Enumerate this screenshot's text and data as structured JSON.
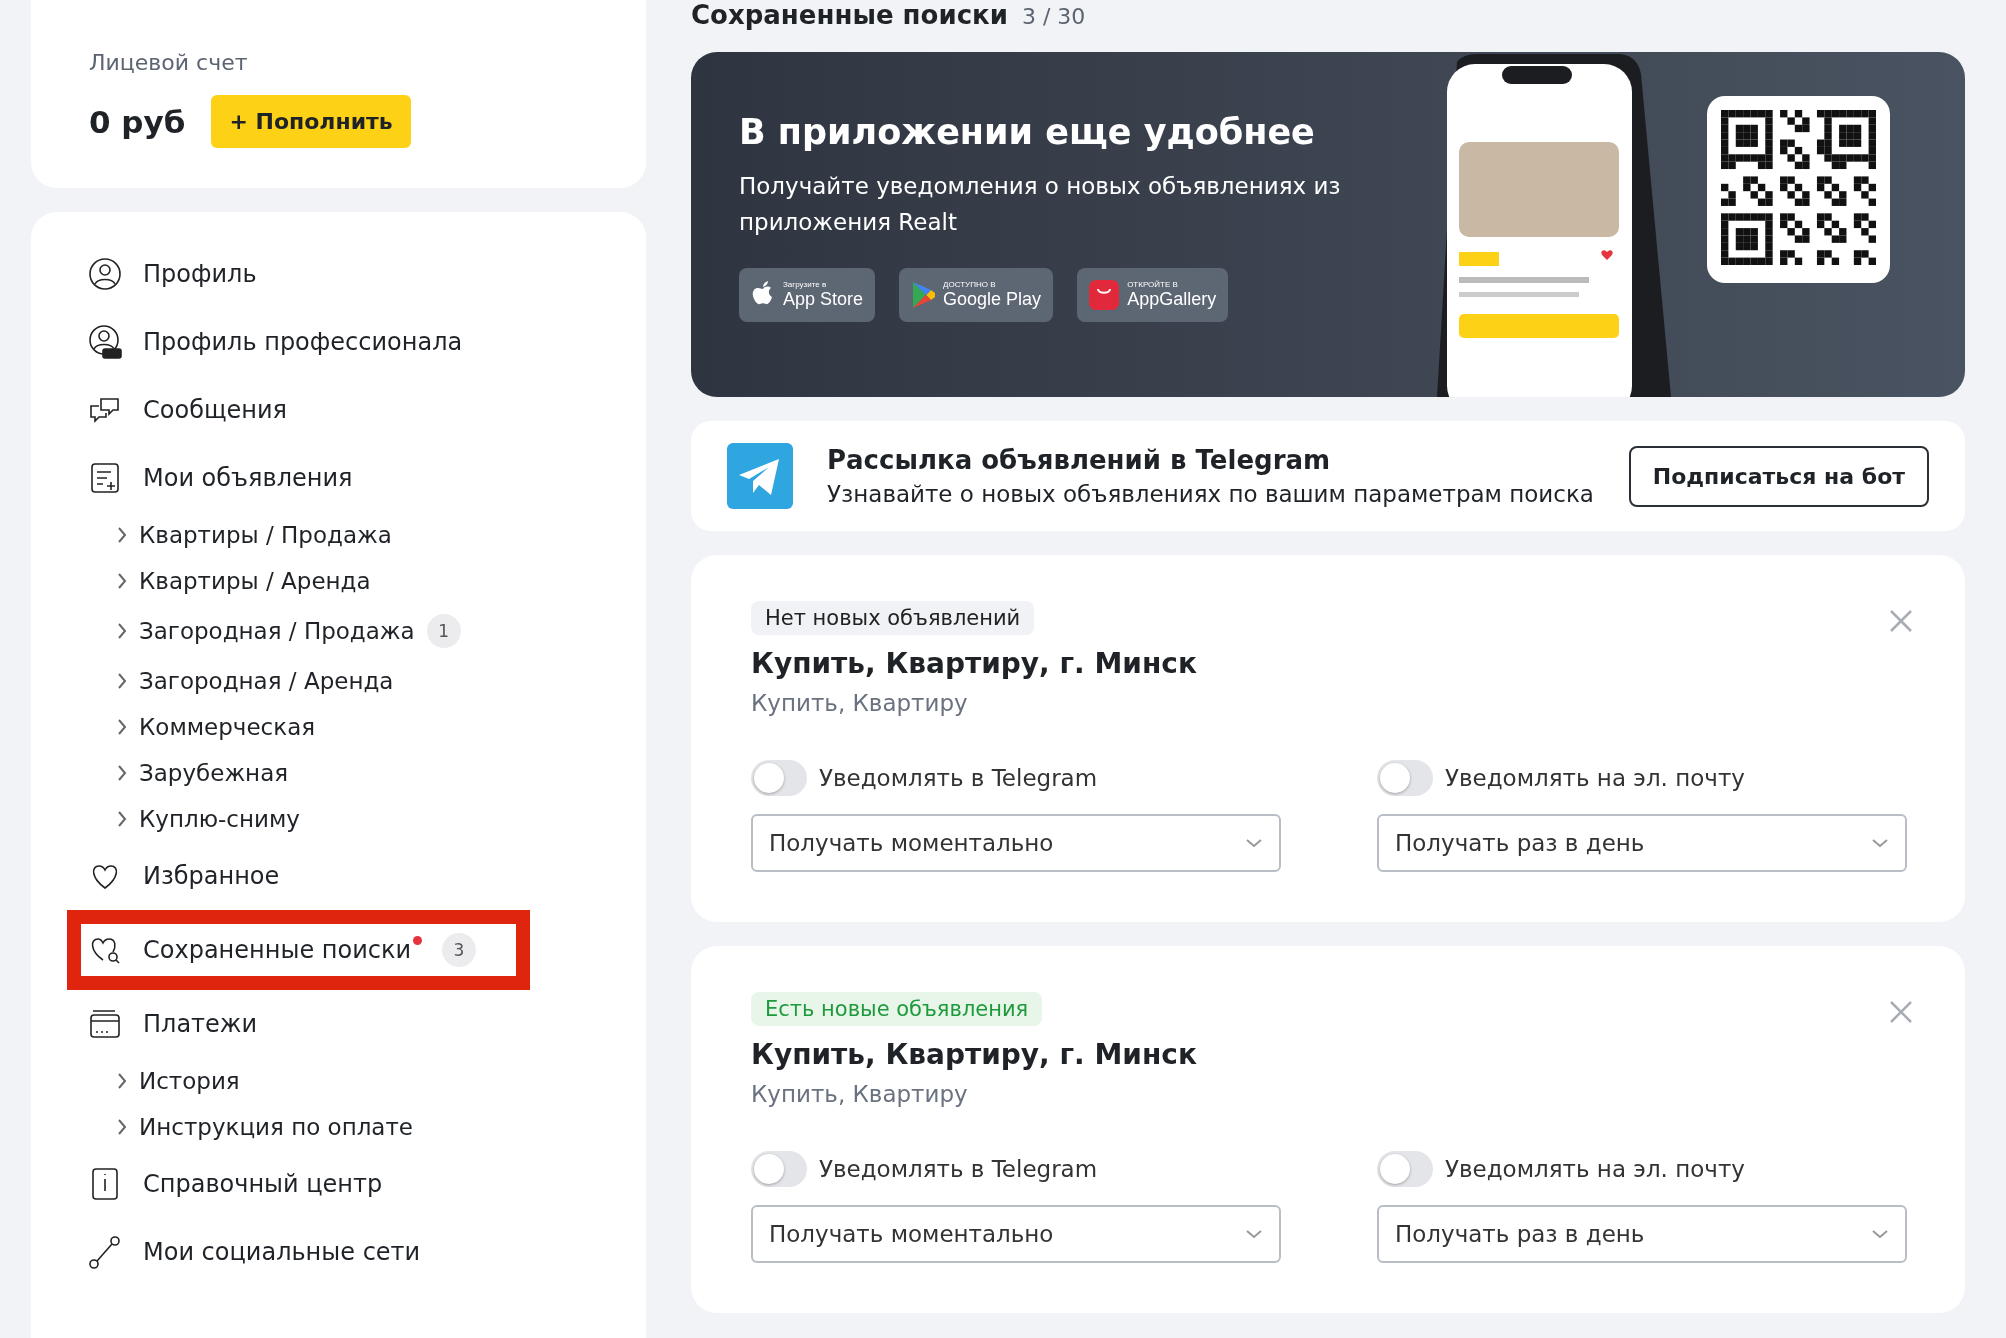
{
  "account": {
    "label": "Лицевой счет",
    "balance": "0 руб",
    "topup_button": "+ Пополнить"
  },
  "nav": [
    {
      "label": "Профиль",
      "highlighted": false
    },
    {
      "label": "Профиль профессионала",
      "highlighted": false
    },
    {
      "label": "Сообщения",
      "highlighted": false
    },
    {
      "label": "Мои объявления",
      "highlighted": false,
      "children": [
        {
          "label": "Квартиры / Продажа"
        },
        {
          "label": "Квартиры / Аренда"
        },
        {
          "label": "Загородная / Продажа",
          "badge": "1"
        },
        {
          "label": "Загородная / Аренда"
        },
        {
          "label": "Коммерческая"
        },
        {
          "label": "Зарубежная"
        },
        {
          "label": "Куплю-сниму"
        }
      ]
    },
    {
      "label": "Избранное",
      "highlighted": false
    },
    {
      "label": "Сохраненные поиски",
      "badge": "3",
      "new_dot": true,
      "highlighted": true
    },
    {
      "label": "Платежи",
      "highlighted": false,
      "children": [
        {
          "label": "История"
        },
        {
          "label": "Инструкция по оплате"
        }
      ]
    },
    {
      "label": "Справочный центр",
      "highlighted": false
    },
    {
      "label": "Мои социальные сети",
      "highlighted": false
    }
  ],
  "heading": {
    "title": "Сохраненные поиски",
    "counter": "3 / 30"
  },
  "banner": {
    "title": "В приложении еще удобнее",
    "text": "Получайте уведомления о новых объявлениях из приложения Realt",
    "store_buttons": [
      {
        "small": "Загрузите в",
        "big": "App Store"
      },
      {
        "small": "ДОСТУПНО В",
        "big": "Google Play"
      },
      {
        "small": "ОТКРОЙТЕ В",
        "big": "AppGallery"
      }
    ]
  },
  "telegram": {
    "title": "Рассылка объявлений в Telegram",
    "text": "Узнавайте о новых объявлениях по вашим параметрам поиска",
    "button": "Подписаться на бот"
  },
  "searches": [
    {
      "status": "Нет новых объявлений",
      "has_new": false,
      "title": "Купить, Квартиру, г. Минск",
      "subtitle": "Купить, Квартиру",
      "notify": [
        {
          "label": "Уведомлять в Telegram",
          "on": false,
          "frequency": "Получать моментально"
        },
        {
          "label": "Уведомлять на эл. почту",
          "on": false,
          "frequency": "Получать раз в день"
        }
      ]
    },
    {
      "status": "Есть новые объявления",
      "has_new": true,
      "title": "Купить, Квартиру, г. Минск",
      "subtitle": "Купить, Квартиру",
      "notify": [
        {
          "label": "Уведомлять в Telegram",
          "on": false,
          "frequency": "Получать моментально"
        },
        {
          "label": "Уведомлять на эл. почту",
          "on": false,
          "frequency": "Получать раз в день"
        }
      ]
    }
  ]
}
